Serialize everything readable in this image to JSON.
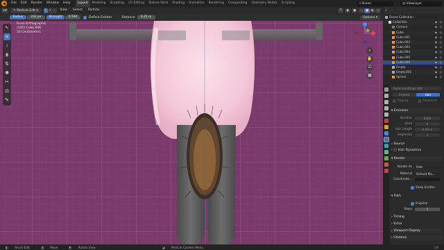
{
  "menu": {
    "items": [
      "File",
      "Edit",
      "Render",
      "Window",
      "Help"
    ],
    "workspaces": [
      "Layout",
      "Modeling",
      "Sculpting",
      "UV Editing",
      "Texture Paint",
      "Shading",
      "Animation",
      "Rendering",
      "Compositing",
      "Geometry Nodes",
      "Scripting"
    ],
    "active_workspace": "Layout",
    "scene": "Scene",
    "view_layer": "ViewLayer"
  },
  "header": {
    "mode": "Particle Edit",
    "view": "View",
    "select": "Select",
    "particle": "Particle",
    "options": "Options"
  },
  "tool_options": {
    "radius_label": "Radius",
    "radius_value": "242 px",
    "strength_label": "Strength",
    "strength_value": "0.500",
    "deflect_label": "Deflect Emitter",
    "distance_label": "Distance",
    "distance_value": "0.25 m"
  },
  "viewport_info": {
    "view": "Front Orthographic",
    "object": "(145) Cube.006",
    "scale": "10 Centimeters"
  },
  "outliner": {
    "title": "Scene Collection",
    "rows": [
      {
        "label": "Scene Collection",
        "indent": 0,
        "color": "#aaaaaa"
      },
      {
        "label": "Collection",
        "indent": 1,
        "color": "#dddddd"
      },
      {
        "label": "Camera",
        "indent": 2,
        "color": "#7a7a7a"
      },
      {
        "label": "Cube",
        "indent": 2,
        "color": "#e39a35"
      },
      {
        "label": "Cube.001",
        "indent": 2,
        "color": "#e39a35"
      },
      {
        "label": "Cube.002",
        "indent": 2,
        "color": "#e39a35"
      },
      {
        "label": "Cube.003",
        "indent": 2,
        "color": "#e39a35"
      },
      {
        "label": "Cube.004",
        "indent": 2,
        "color": "#e39a35"
      },
      {
        "label": "Cube.005",
        "indent": 2,
        "color": "#e39a35"
      },
      {
        "label": "Cube.006",
        "indent": 2,
        "color": "#e39a35",
        "selected": true
      },
      {
        "label": "Empty",
        "indent": 2,
        "color": "#aaaaaa"
      },
      {
        "label": "Empty.001",
        "indent": 2,
        "color": "#aaaaaa"
      },
      {
        "label": "Sphere",
        "indent": 2,
        "color": "#e39a35"
      }
    ]
  },
  "properties": {
    "settings_name": "ParticleSettings.002",
    "type_emitter": "Emitter",
    "type_hair": "Hair",
    "regrow": "Regrow",
    "advanced": "Advanced",
    "emission": {
      "title": "Emission",
      "number_label": "Number",
      "number": "2000",
      "seed_label": "Seed",
      "seed": "0",
      "hair_length_label": "Hair Length",
      "hair_length": "0.66 m",
      "segments_label": "Segments",
      "segments": "5"
    },
    "source": "Source",
    "hair_dynamics": "Hair Dynamics",
    "render": {
      "title": "Render",
      "render_as_label": "Render As",
      "render_as": "Path",
      "material_label": "Material",
      "material": "Default Ma...",
      "coordinate_label": "Coordinate..."
    },
    "show_emitter": "Show Emitter",
    "path": {
      "title": "Path",
      "bspline": "B-Spline",
      "steps_label": "Steps",
      "steps": "7"
    },
    "timing": "Timing",
    "extra": "Extra",
    "viewport_display": "Viewport Display",
    "children": "Children"
  },
  "status": {
    "items": [
      "Brush Edit",
      "Move",
      "Rotate View",
      "Particle Context Menu"
    ],
    "version": "3.6"
  },
  "colors": {
    "accent": "#4772b3",
    "viewport_bg": "#7a3a6b",
    "selection": "#334d80"
  }
}
